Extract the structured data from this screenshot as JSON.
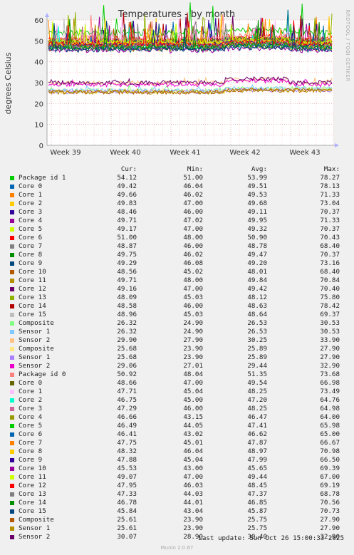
{
  "chart_data": {
    "type": "line",
    "title": "Temperatures - by month",
    "ylabel": "degrees Celsius",
    "ylim": [
      0,
      60
    ],
    "yticks": [
      "0",
      "10",
      "20",
      "30",
      "40",
      "50",
      "60"
    ],
    "xtick_labels": [
      "Week 39",
      "Week 40",
      "Week 41",
      "Week 42",
      "Week 43"
    ],
    "side_label": "RRDTOOL / TOBI OETIKER",
    "legend_headers": {
      "cur": "Cur:",
      "min": "Min:",
      "avg": "Avg:",
      "max": "Max:"
    },
    "series": [
      {
        "name": "Package id 1",
        "color": "#00cc00",
        "cur": "54.12",
        "min": "51.00",
        "avg": "53.99",
        "max": "78.27"
      },
      {
        "name": "Core 0",
        "color": "#0066b3",
        "cur": "49.42",
        "min": "46.04",
        "avg": "49.51",
        "max": "78.13"
      },
      {
        "name": "Core 1",
        "color": "#ff8000",
        "cur": "49.66",
        "min": "46.02",
        "avg": "49.53",
        "max": "71.33"
      },
      {
        "name": "Core 2",
        "color": "#ffcc00",
        "cur": "49.83",
        "min": "47.00",
        "avg": "49.68",
        "max": "73.04"
      },
      {
        "name": "Core 3",
        "color": "#330099",
        "cur": "48.46",
        "min": "46.00",
        "avg": "49.11",
        "max": "70.37"
      },
      {
        "name": "Core 4",
        "color": "#990099",
        "cur": "49.71",
        "min": "47.02",
        "avg": "49.95",
        "max": "71.33"
      },
      {
        "name": "Core 5",
        "color": "#ccff00",
        "cur": "49.17",
        "min": "47.00",
        "avg": "49.32",
        "max": "70.37"
      },
      {
        "name": "Core 6",
        "color": "#ff0000",
        "cur": "51.00",
        "min": "48.00",
        "avg": "50.90",
        "max": "70.43"
      },
      {
        "name": "Core 7",
        "color": "#808080",
        "cur": "48.87",
        "min": "46.00",
        "avg": "48.78",
        "max": "68.40"
      },
      {
        "name": "Core 8",
        "color": "#008f00",
        "cur": "49.75",
        "min": "46.02",
        "avg": "49.47",
        "max": "70.37"
      },
      {
        "name": "Core 9",
        "color": "#00487d",
        "cur": "49.29",
        "min": "46.08",
        "avg": "49.20",
        "max": "73.16"
      },
      {
        "name": "Core 10",
        "color": "#b35a00",
        "cur": "48.56",
        "min": "45.02",
        "avg": "48.01",
        "max": "68.40"
      },
      {
        "name": "Core 11",
        "color": "#b38f00",
        "cur": "49.71",
        "min": "48.00",
        "avg": "49.84",
        "max": "70.84"
      },
      {
        "name": "Core 12",
        "color": "#6b006b",
        "cur": "49.16",
        "min": "47.00",
        "avg": "49.42",
        "max": "70.40"
      },
      {
        "name": "Core 13",
        "color": "#8fb300",
        "cur": "48.09",
        "min": "45.03",
        "avg": "48.12",
        "max": "75.80"
      },
      {
        "name": "Core 14",
        "color": "#b30000",
        "cur": "48.58",
        "min": "46.00",
        "avg": "48.63",
        "max": "78.42"
      },
      {
        "name": "Core 15",
        "color": "#bebebe",
        "cur": "48.96",
        "min": "45.03",
        "avg": "48.64",
        "max": "69.37"
      },
      {
        "name": "Composite",
        "color": "#80ff80",
        "cur": "26.32",
        "min": "24.90",
        "avg": "26.53",
        "max": "30.53"
      },
      {
        "name": "Sensor 1",
        "color": "#80c9ff",
        "cur": "26.32",
        "min": "24.90",
        "avg": "26.53",
        "max": "30.53"
      },
      {
        "name": "Sensor 2",
        "color": "#ffc080",
        "cur": "29.90",
        "min": "27.90",
        "avg": "30.25",
        "max": "33.90"
      },
      {
        "name": "Composite",
        "color": "#ffe680",
        "cur": "25.68",
        "min": "23.90",
        "avg": "25.89",
        "max": "27.90"
      },
      {
        "name": "Sensor 1",
        "color": "#aa80ff",
        "cur": "25.68",
        "min": "23.90",
        "avg": "25.89",
        "max": "27.90"
      },
      {
        "name": "Sensor 2",
        "color": "#ee00cc",
        "cur": "29.06",
        "min": "27.01",
        "avg": "29.44",
        "max": "32.90"
      },
      {
        "name": "Package id 0",
        "color": "#ff8080",
        "cur": "50.92",
        "min": "48.04",
        "avg": "51.35",
        "max": "73.68"
      },
      {
        "name": "Core 0",
        "color": "#666600",
        "cur": "48.66",
        "min": "47.00",
        "avg": "49.54",
        "max": "66.98"
      },
      {
        "name": "Core 1",
        "color": "#ffbfff",
        "cur": "47.71",
        "min": "45.04",
        "avg": "48.25",
        "max": "73.49"
      },
      {
        "name": "Core 2",
        "color": "#00ffcc",
        "cur": "46.75",
        "min": "45.00",
        "avg": "47.20",
        "max": "64.76"
      },
      {
        "name": "Core 3",
        "color": "#cc6699",
        "cur": "47.29",
        "min": "46.00",
        "avg": "48.25",
        "max": "64.98"
      },
      {
        "name": "Core 4",
        "color": "#999900",
        "cur": "46.66",
        "min": "43.15",
        "avg": "46.47",
        "max": "64.00"
      },
      {
        "name": "Core 5",
        "color": "#00cc00",
        "cur": "46.49",
        "min": "44.05",
        "avg": "47.41",
        "max": "65.98"
      },
      {
        "name": "Core 6",
        "color": "#0066b3",
        "cur": "46.41",
        "min": "43.02",
        "avg": "46.62",
        "max": "65.00"
      },
      {
        "name": "Core 7",
        "color": "#ff8000",
        "cur": "47.75",
        "min": "45.01",
        "avg": "47.87",
        "max": "66.67"
      },
      {
        "name": "Core 8",
        "color": "#ffcc00",
        "cur": "48.32",
        "min": "46.04",
        "avg": "48.97",
        "max": "70.98"
      },
      {
        "name": "Core 9",
        "color": "#330099",
        "cur": "47.88",
        "min": "45.04",
        "avg": "47.99",
        "max": "66.50"
      },
      {
        "name": "Core 10",
        "color": "#990099",
        "cur": "45.53",
        "min": "43.00",
        "avg": "45.65",
        "max": "69.39"
      },
      {
        "name": "Core 11",
        "color": "#ccff00",
        "cur": "49.07",
        "min": "47.00",
        "avg": "49.44",
        "max": "67.00"
      },
      {
        "name": "Core 12",
        "color": "#ff0000",
        "cur": "47.95",
        "min": "46.03",
        "avg": "48.45",
        "max": "69.19"
      },
      {
        "name": "Core 13",
        "color": "#808080",
        "cur": "47.33",
        "min": "44.03",
        "avg": "47.37",
        "max": "68.78"
      },
      {
        "name": "Core 14",
        "color": "#008f00",
        "cur": "46.78",
        "min": "44.01",
        "avg": "46.85",
        "max": "70.56"
      },
      {
        "name": "Core 15",
        "color": "#00487d",
        "cur": "45.84",
        "min": "43.04",
        "avg": "45.87",
        "max": "70.73"
      },
      {
        "name": "Composite",
        "color": "#b35a00",
        "cur": "25.61",
        "min": "23.90",
        "avg": "25.75",
        "max": "27.90"
      },
      {
        "name": "Sensor 1",
        "color": "#b38f00",
        "cur": "25.61",
        "min": "23.90",
        "avg": "25.75",
        "max": "27.90"
      },
      {
        "name": "Sensor 2",
        "color": "#6b006b",
        "cur": "30.07",
        "min": "28.90",
        "avg": "30.40",
        "max": "32.90"
      }
    ]
  },
  "footer": {
    "last_update": "Last update:  Sun Oct 26 15:00:33 2025",
    "munin_version": "Munin 2.0.67"
  }
}
